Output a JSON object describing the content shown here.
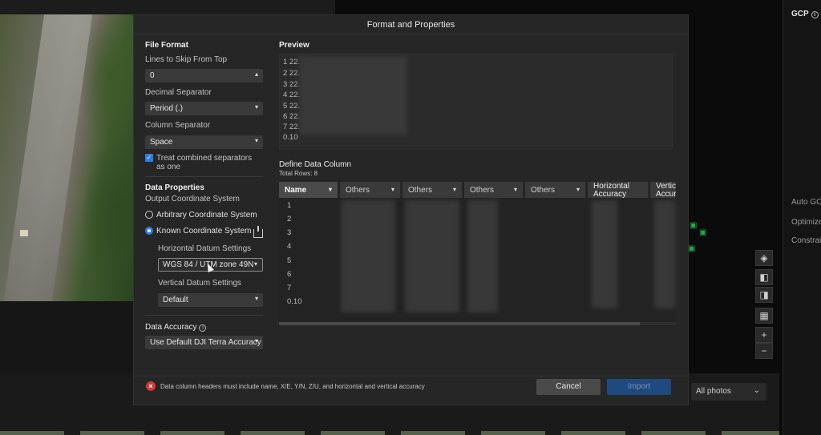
{
  "background": {
    "right_panel": {
      "title": "GCP",
      "labels": [
        "Auto GCP",
        "Optimize",
        "Constrain"
      ]
    },
    "photo_filter": "All photos",
    "map_tools": [
      "zoom-in",
      "zoom-out"
    ]
  },
  "dialog": {
    "title": "Format and Properties",
    "file_format": {
      "heading": "File Format",
      "lines_to_skip_label": "Lines to Skip From Top",
      "lines_to_skip_value": "0",
      "decimal_separator_label": "Decimal Separator",
      "decimal_separator_value": "Period (.)",
      "column_separator_label": "Column Separator",
      "column_separator_value": "Space",
      "treat_combined_label": "Treat combined separators as one",
      "treat_combined_checked": true
    },
    "data_properties": {
      "heading": "Data Properties",
      "output_cs_label": "Output Coordinate System",
      "arbitrary_cs_label": "Arbitrary Coordinate System",
      "known_cs_label": "Known Coordinate System",
      "selected_cs": "known",
      "horizontal_datum_label": "Horizontal Datum Settings",
      "horizontal_datum_value": "WGS 84 / UTM zone 49N",
      "vertical_datum_label": "Vertical Datum Settings",
      "vertical_datum_value": "Default"
    },
    "data_accuracy": {
      "heading": "Data Accuracy",
      "value": "Use Default DJI Terra Accuracy"
    },
    "preview": {
      "heading": "Preview",
      "lines": [
        "1 22.",
        "2 22.",
        "3 22.",
        "4 22.",
        "5 22.",
        "6 22.",
        "7 22.",
        "0.10"
      ]
    },
    "define_columns": {
      "heading": "Define Data Column",
      "total_rows": "Total Rows: 8",
      "headers": [
        "Name",
        "Others",
        "Others",
        "Others",
        "Others",
        "Horizontal Accuracy",
        "Vertical Accuracy"
      ],
      "row_names": [
        "1",
        "2",
        "3",
        "4",
        "5",
        "6",
        "7",
        "0.10"
      ]
    },
    "error_message": "Data column headers must include name, X/E, Y/N, Z/U, and horizontal and vertical accuracy",
    "cancel_label": "Cancel",
    "import_label": "Import"
  }
}
